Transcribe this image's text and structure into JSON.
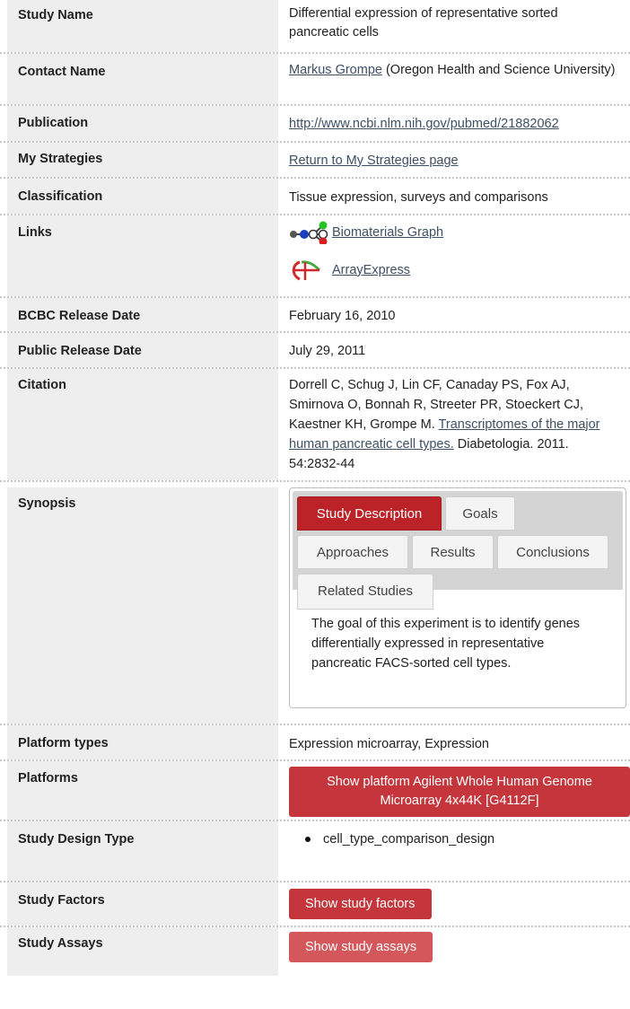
{
  "fields": {
    "study_name": {
      "label": "Study Name",
      "value": "Differential expression of representative sorted pancreatic cells"
    },
    "contact_name": {
      "label": "Contact Name",
      "link": "Markus Grompe",
      "extra": " (Oregon Health and Science University)"
    },
    "publication": {
      "label": "Publication",
      "link": "http://www.ncbi.nlm.nih.gov/pubmed/21882062"
    },
    "my_strategies": {
      "label": "My Strategies",
      "link": "Return to My Strategies page"
    },
    "classification": {
      "label": "Classification",
      "value": "Tissue expression, surveys and comparisons"
    },
    "links": {
      "label": "Links",
      "items": [
        "Biomaterials Graph",
        "ArrayExpress"
      ]
    },
    "bcbc_release_date": {
      "label": "BCBC Release Date",
      "value": "February 16, 2010"
    },
    "public_release_date": {
      "label": "Public Release Date",
      "value": "July 29, 2011"
    },
    "citation": {
      "label": "Citation",
      "authors": "Dorrell C, Schug J, Lin CF, Canaday PS, Fox AJ, Smirnova O, Bonnah R, Streeter PR, Stoeckert CJ, Kaestner KH, Grompe M. ",
      "title_link": "Transcriptomes of the major human pancreatic cell types.",
      "journal": " Diabetologia. 2011. 54:2832-44"
    },
    "synopsis": {
      "label": "Synopsis",
      "tabs": [
        "Study Description",
        "Goals",
        "Approaches",
        "Results",
        "Conclusions",
        "Related Studies"
      ],
      "active_tab": "Study Description",
      "text": "The goal of this experiment is to identify genes differentially expressed in representative pancreatic FACS-sorted cell types."
    },
    "platform_types": {
      "label": "Platform types",
      "value": "Expression microarray, Expression"
    },
    "platforms": {
      "label": "Platforms",
      "button": "Show platform Agilent Whole Human Genome Microarray 4x44K [G4112F]"
    },
    "study_design_type": {
      "label": "Study Design Type",
      "items": [
        "cell_type_comparison_design"
      ]
    },
    "study_factors": {
      "label": "Study Factors",
      "button": "Show study factors"
    },
    "study_assays": {
      "label": "Study Assays",
      "button": "Show study assays"
    }
  },
  "colors": {
    "accent_red": "#c4363c",
    "link": "#3d4f63",
    "label_bg": "#eeeeee"
  },
  "icons": [
    "biomaterials-graph-icon",
    "arrayexpress-icon"
  ]
}
